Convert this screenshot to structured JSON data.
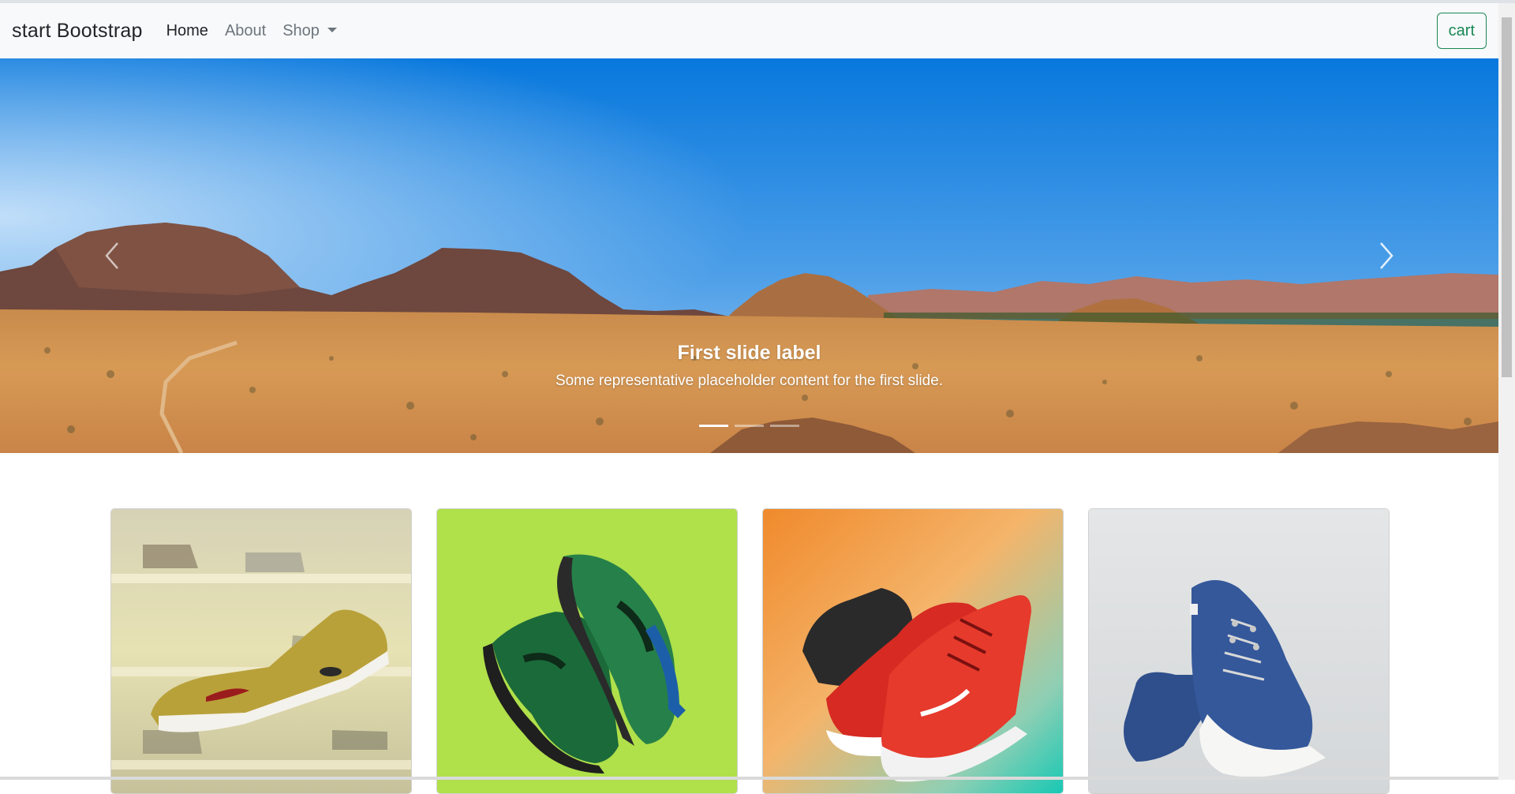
{
  "navbar": {
    "brand": "start Bootstrap",
    "links": [
      {
        "label": "Home",
        "active": true
      },
      {
        "label": "About",
        "active": false
      },
      {
        "label": "Shop",
        "dropdown": true
      }
    ],
    "cart_label": "cart"
  },
  "carousel": {
    "caption_title": "First slide label",
    "caption_text": "Some representative placeholder content for the first slide.",
    "slides": 3,
    "active_index": 0
  },
  "products": [
    {
      "image": "olive-sneaker-on-shelf"
    },
    {
      "image": "green-running-shoes-on-lime"
    },
    {
      "image": "red-sneakers-on-orange-teal"
    },
    {
      "image": "blue-canvas-shoes-on-white"
    }
  ],
  "colors": {
    "navbar_bg": "#f8f9fa",
    "accent_success": "#198754",
    "muted_text": "#6c757d"
  }
}
